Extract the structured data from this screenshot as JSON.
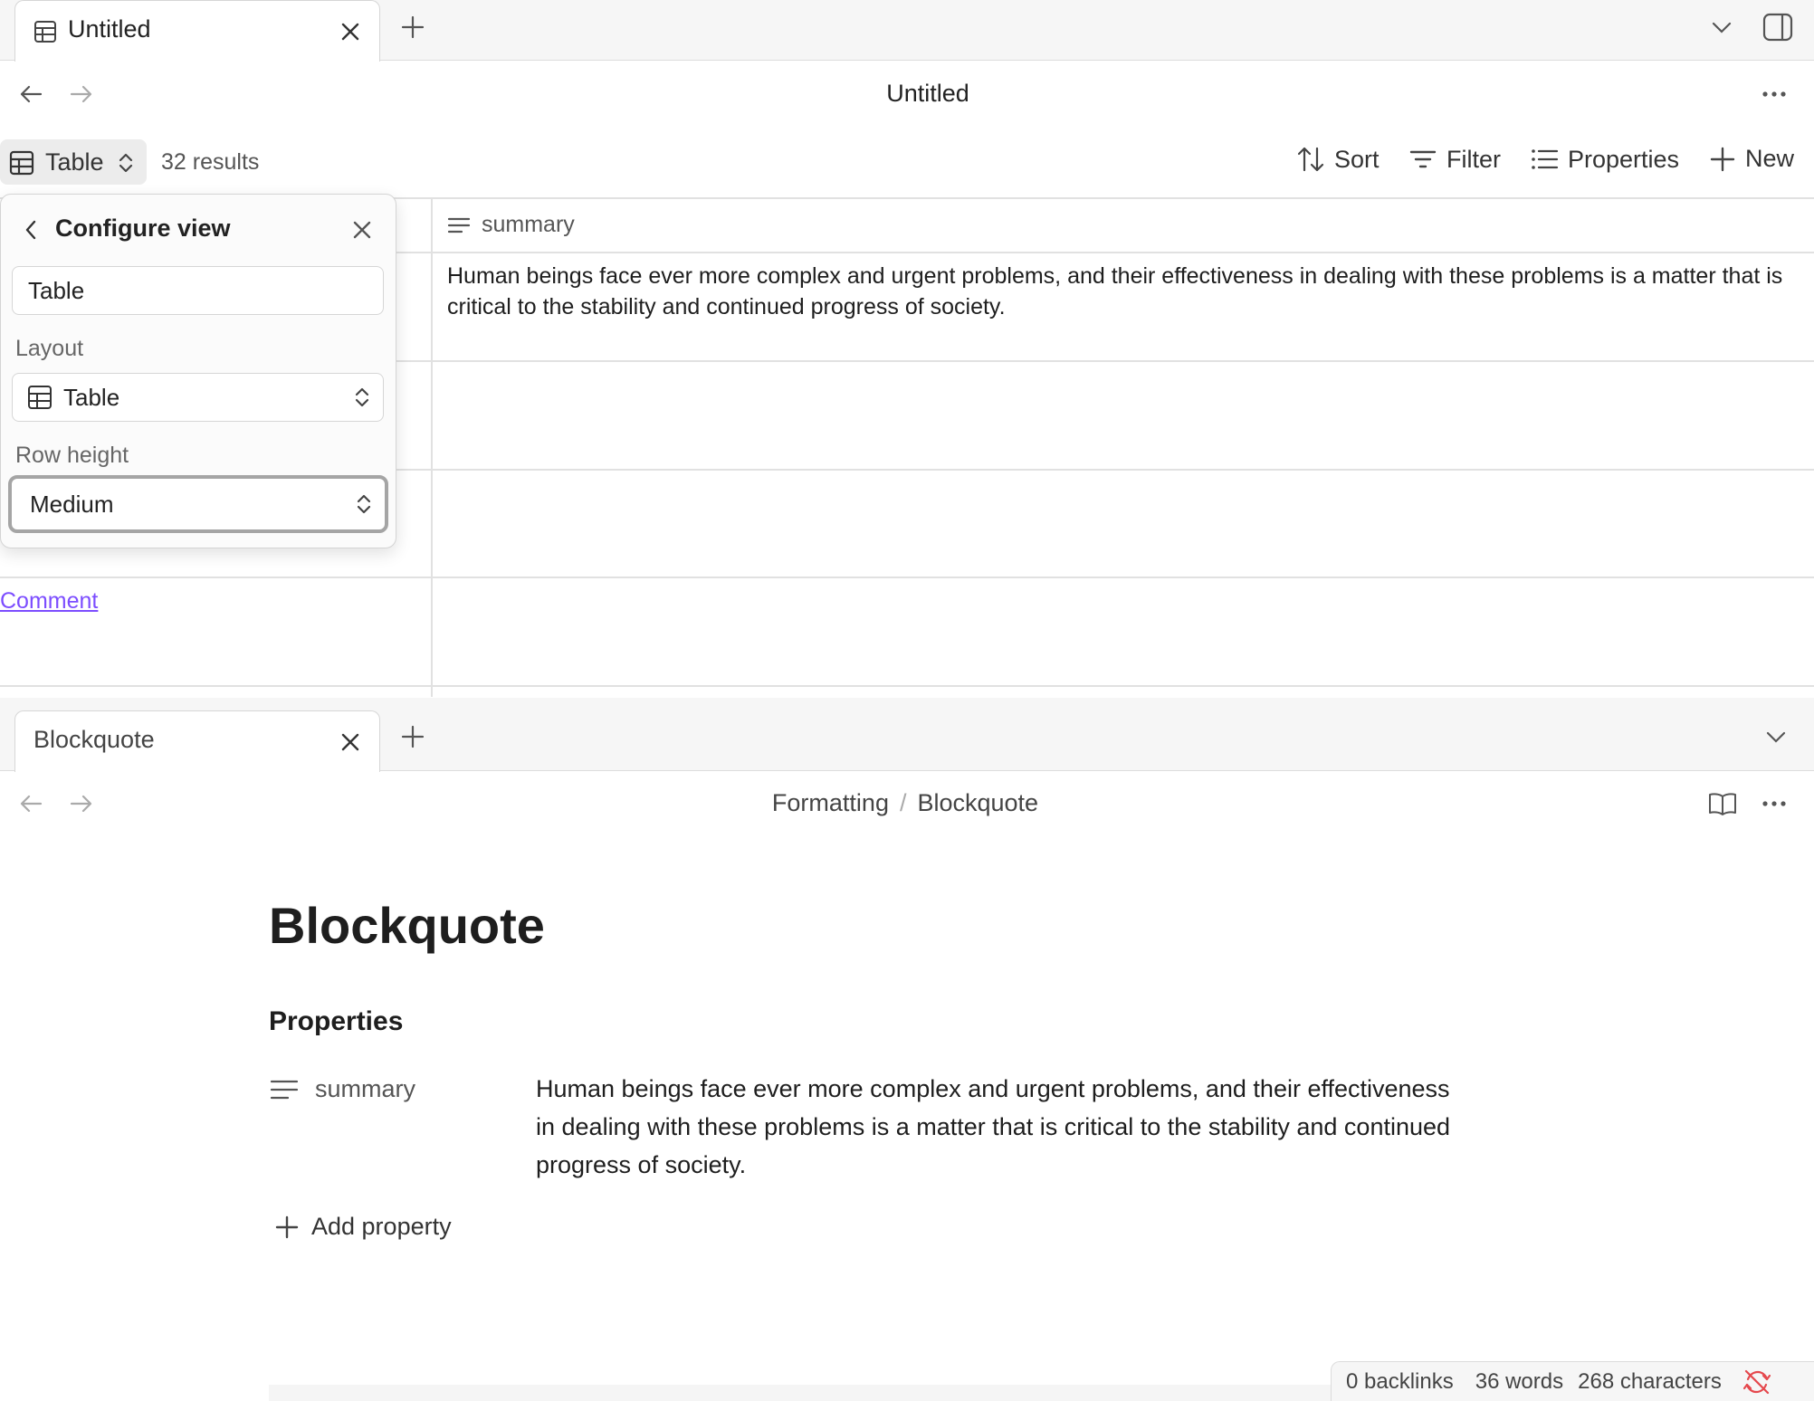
{
  "top_pane": {
    "tab": {
      "label": "Untitled",
      "icon": "table-icon"
    },
    "header": {
      "title": "Untitled"
    },
    "toolbar": {
      "view_label": "Table",
      "results": "32 results",
      "sort": "Sort",
      "filter": "Filter",
      "properties": "Properties",
      "new": "New"
    },
    "table": {
      "column_header": "summary",
      "rows": [
        {
          "summary": "Human beings face ever more complex and urgent problems, and their effectiveness in dealing with these problems is a matter that is critical to the stability and continued progress of society."
        },
        {
          "summary": ""
        },
        {
          "summary": ""
        },
        {
          "summary": ""
        }
      ],
      "comment_link": "Comment"
    },
    "configure_view": {
      "title": "Configure view",
      "view_name_value": "Table",
      "layout_label": "Layout",
      "layout_value": "Table",
      "row_height_label": "Row height",
      "row_height_value": "Medium"
    }
  },
  "bottom_pane": {
    "tab": {
      "label": "Blockquote"
    },
    "breadcrumb": {
      "parent": "Formatting",
      "separator": "/",
      "current": "Blockquote"
    },
    "doc": {
      "title": "Blockquote",
      "properties_heading": "Properties",
      "property_key": "summary",
      "property_value": "Human beings face ever more complex and urgent problems, and their effectiveness in dealing with these problems is a matter that is critical to the stability and continued progress of society.",
      "add_property": "Add property"
    },
    "status_bar": {
      "backlinks": "0 backlinks",
      "words": "36 words",
      "characters": "268 characters"
    }
  },
  "colors": {
    "link": "#7c4dff",
    "sync_error": "#e5484d"
  }
}
